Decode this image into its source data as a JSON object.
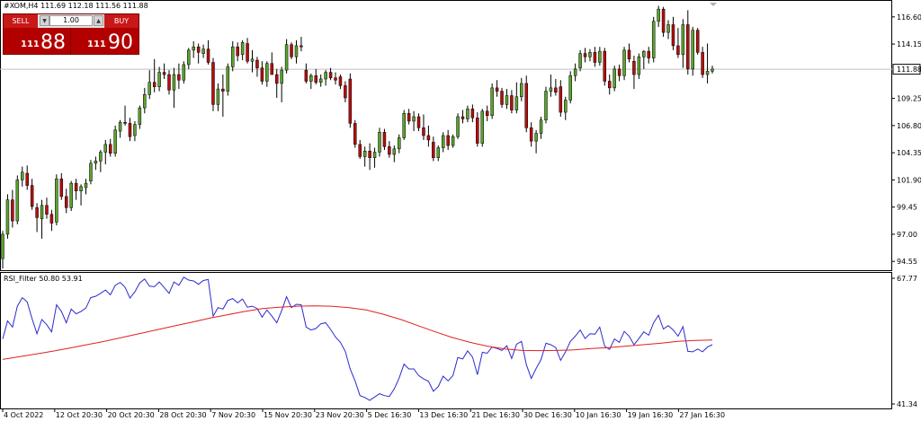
{
  "header": {
    "title": "#XOM,H4  111.69 112.18 111.56 111.88"
  },
  "trade_panel": {
    "sell_label": "SELL",
    "buy_label": "BUY",
    "lot": "1.00",
    "sell_price_small": "111",
    "sell_price_big": "88",
    "buy_price_small": "111",
    "buy_price_big": "90",
    "down_arrow": "▼",
    "up_arrow": "▲"
  },
  "colors": {
    "bull": "#5aa32d",
    "bear": "#b50e0e",
    "wick": "#000000",
    "price_line": "#c0c0c0",
    "price_label_bg": "#ffffff",
    "rsi_line": "#2b2bd0",
    "ma_line": "#e02020",
    "grid_border": "#000000"
  },
  "chart_data": [
    {
      "type": "candlestick",
      "title": "#XOM,H4  111.69 112.18 111.56 111.88",
      "y_ticks": [
        "116.60",
        "114.15",
        "111.88",
        "109.25",
        "106.80",
        "104.35",
        "101.90",
        "99.45",
        "97.00",
        "94.55"
      ],
      "current_price": "111.88",
      "ylim": [
        94.0,
        117.8
      ],
      "grid": false,
      "candles": [
        [
          94.8,
          97.3,
          93.9,
          97.0
        ],
        [
          97.0,
          100.6,
          96.6,
          100.1
        ],
        [
          100.1,
          101.0,
          97.6,
          98.2
        ],
        [
          98.2,
          102.3,
          97.9,
          101.9
        ],
        [
          101.9,
          103.1,
          101.3,
          102.6
        ],
        [
          102.5,
          103.2,
          101.0,
          101.4
        ],
        [
          101.4,
          102.0,
          99.2,
          99.5
        ],
        [
          99.4,
          99.8,
          97.2,
          98.5
        ],
        [
          98.4,
          100.1,
          96.6,
          99.6
        ],
        [
          99.6,
          100.3,
          98.4,
          98.8
        ],
        [
          98.8,
          99.2,
          97.3,
          98.0
        ],
        [
          98.1,
          102.4,
          97.8,
          102.0
        ],
        [
          102.0,
          102.5,
          100.1,
          100.4
        ],
        [
          100.4,
          101.1,
          98.9,
          99.4
        ],
        [
          99.4,
          101.8,
          99.1,
          101.6
        ],
        [
          101.6,
          102.0,
          100.1,
          100.9
        ],
        [
          100.9,
          101.5,
          99.6,
          101.3
        ],
        [
          101.2,
          102.0,
          100.6,
          101.6
        ],
        [
          101.8,
          103.7,
          101.5,
          103.4
        ],
        [
          103.4,
          104.0,
          102.8,
          103.6
        ],
        [
          103.6,
          104.6,
          102.6,
          104.4
        ],
        [
          104.4,
          105.5,
          103.3,
          105.1
        ],
        [
          105.1,
          105.6,
          104.0,
          104.3
        ],
        [
          104.3,
          106.8,
          104.0,
          106.4
        ],
        [
          106.3,
          107.3,
          105.7,
          107.1
        ],
        [
          107.1,
          108.6,
          106.8,
          107.0
        ],
        [
          107.0,
          107.5,
          105.4,
          105.8
        ],
        [
          105.9,
          107.2,
          105.4,
          106.9
        ],
        [
          106.9,
          108.6,
          106.5,
          108.4
        ],
        [
          108.4,
          110.2,
          107.9,
          109.6
        ],
        [
          109.6,
          111.8,
          109.2,
          110.7
        ],
        [
          110.7,
          112.8,
          109.8,
          110.3
        ],
        [
          110.3,
          112.1,
          109.9,
          111.6
        ],
        [
          111.6,
          112.4,
          111.0,
          111.4
        ],
        [
          111.4,
          111.8,
          109.6,
          110.0
        ],
        [
          110.0,
          112.0,
          108.4,
          111.4
        ],
        [
          111.4,
          112.4,
          110.1,
          110.9
        ],
        [
          110.9,
          112.6,
          110.6,
          112.3
        ],
        [
          112.3,
          113.8,
          111.9,
          113.6
        ],
        [
          113.6,
          114.4,
          112.9,
          113.9
        ],
        [
          113.9,
          114.2,
          112.4,
          113.4
        ],
        [
          113.3,
          114.1,
          112.9,
          113.7
        ],
        [
          113.7,
          114.5,
          112.3,
          112.5
        ],
        [
          112.5,
          112.9,
          108.1,
          108.7
        ],
        [
          108.7,
          110.6,
          108.1,
          110.1
        ],
        [
          110.1,
          111.4,
          107.6,
          109.9
        ],
        [
          109.9,
          112.4,
          109.5,
          112.1
        ],
        [
          112.1,
          114.4,
          111.7,
          113.9
        ],
        [
          113.9,
          114.3,
          112.6,
          113.1
        ],
        [
          113.2,
          114.5,
          112.7,
          114.3
        ],
        [
          114.2,
          114.7,
          112.4,
          112.6
        ],
        [
          112.6,
          113.6,
          111.6,
          112.8
        ],
        [
          112.7,
          113.0,
          111.2,
          112.0
        ],
        [
          112.0,
          112.6,
          110.5,
          110.8
        ],
        [
          110.8,
          112.6,
          110.3,
          112.4
        ],
        [
          112.4,
          113.4,
          111.6,
          111.4
        ],
        [
          111.4,
          111.9,
          109.3,
          110.6
        ],
        [
          110.6,
          112.1,
          108.9,
          111.8
        ],
        [
          111.8,
          114.6,
          111.5,
          114.1
        ],
        [
          114.1,
          114.3,
          112.8,
          113.0
        ],
        [
          113.0,
          114.5,
          112.4,
          114.0
        ],
        [
          114.0,
          114.8,
          113.5,
          113.9
        ],
        [
          111.8,
          112.4,
          110.6,
          110.8
        ],
        [
          110.8,
          111.5,
          110.1,
          111.3
        ],
        [
          111.3,
          111.9,
          110.5,
          110.7
        ],
        [
          110.7,
          111.4,
          110.3,
          111.0
        ],
        [
          111.0,
          111.8,
          110.4,
          111.6
        ],
        [
          111.6,
          112.0,
          110.9,
          111.1
        ],
        [
          111.1,
          111.6,
          110.5,
          110.9
        ],
        [
          111.2,
          111.4,
          110.1,
          110.4
        ],
        [
          110.4,
          110.8,
          108.9,
          109.3
        ],
        [
          111.0,
          111.5,
          106.6,
          107.0
        ],
        [
          107.0,
          107.3,
          104.8,
          105.1
        ],
        [
          105.1,
          105.5,
          103.8,
          104.0
        ],
        [
          104.0,
          104.9,
          103.1,
          104.5
        ],
        [
          104.5,
          105.2,
          102.8,
          103.9
        ],
        [
          103.9,
          104.8,
          103.0,
          104.4
        ],
        [
          104.4,
          106.6,
          104.0,
          106.2
        ],
        [
          106.2,
          106.5,
          104.6,
          104.9
        ],
        [
          104.9,
          105.4,
          103.9,
          104.2
        ],
        [
          104.2,
          105.0,
          103.5,
          104.7
        ],
        [
          104.7,
          106.0,
          104.3,
          105.7
        ],
        [
          105.7,
          108.2,
          105.5,
          107.9
        ],
        [
          107.9,
          108.3,
          106.9,
          107.2
        ],
        [
          107.2,
          108.1,
          106.3,
          107.6
        ],
        [
          107.6,
          107.9,
          106.3,
          106.6
        ],
        [
          106.6,
          107.8,
          105.5,
          105.9
        ],
        [
          105.9,
          106.8,
          104.9,
          105.5
        ],
        [
          105.3,
          105.8,
          103.6,
          103.9
        ],
        [
          103.9,
          105.0,
          103.6,
          104.8
        ],
        [
          104.8,
          106.2,
          104.4,
          105.9
        ],
        [
          105.9,
          106.4,
          104.6,
          105.0
        ],
        [
          105.0,
          106.0,
          104.8,
          105.8
        ],
        [
          105.8,
          107.9,
          105.6,
          107.6
        ],
        [
          107.6,
          108.2,
          107.0,
          107.4
        ],
        [
          107.4,
          108.6,
          107.1,
          108.3
        ],
        [
          108.3,
          108.7,
          107.1,
          107.5
        ],
        [
          107.5,
          108.0,
          104.9,
          105.2
        ],
        [
          105.2,
          108.3,
          104.9,
          108.1
        ],
        [
          108.1,
          108.6,
          107.2,
          107.7
        ],
        [
          107.7,
          110.6,
          107.4,
          110.2
        ],
        [
          110.2,
          110.9,
          109.4,
          109.9
        ],
        [
          109.9,
          110.2,
          108.4,
          108.7
        ],
        [
          108.7,
          110.1,
          108.3,
          109.5
        ],
        [
          109.5,
          110.0,
          107.9,
          108.2
        ],
        [
          108.2,
          110.7,
          107.9,
          109.4
        ],
        [
          109.4,
          111.1,
          109.0,
          110.6
        ],
        [
          110.6,
          111.3,
          106.2,
          106.6
        ],
        [
          106.6,
          107.1,
          104.9,
          105.4
        ],
        [
          105.4,
          106.4,
          104.3,
          106.1
        ],
        [
          106.1,
          107.6,
          105.6,
          107.3
        ],
        [
          107.3,
          110.3,
          107.0,
          109.9
        ],
        [
          109.9,
          111.4,
          109.4,
          110.2
        ],
        [
          110.2,
          111.0,
          109.5,
          109.8
        ],
        [
          110.3,
          110.9,
          107.6,
          108.0
        ],
        [
          108.0,
          109.4,
          107.3,
          109.1
        ],
        [
          109.1,
          111.7,
          108.8,
          111.3
        ],
        [
          111.3,
          112.4,
          110.8,
          111.9
        ],
        [
          112.0,
          113.6,
          111.7,
          113.3
        ],
        [
          113.3,
          113.8,
          112.5,
          113.0
        ],
        [
          113.0,
          113.7,
          112.6,
          113.4
        ],
        [
          113.4,
          113.9,
          112.1,
          112.5
        ],
        [
          112.5,
          113.9,
          112.2,
          113.5
        ],
        [
          113.5,
          113.8,
          110.4,
          110.8
        ],
        [
          110.8,
          111.4,
          109.6,
          110.2
        ],
        [
          110.2,
          112.2,
          109.9,
          111.9
        ],
        [
          111.9,
          112.3,
          110.8,
          111.3
        ],
        [
          111.3,
          113.9,
          110.9,
          113.6
        ],
        [
          113.6,
          114.2,
          112.5,
          112.8
        ],
        [
          112.6,
          113.1,
          110.1,
          111.4
        ],
        [
          111.4,
          113.3,
          111.0,
          113.0
        ],
        [
          113.0,
          113.6,
          111.9,
          113.5
        ],
        [
          113.5,
          113.9,
          112.4,
          112.9
        ],
        [
          112.9,
          116.6,
          112.5,
          116.2
        ],
        [
          116.2,
          117.6,
          115.7,
          117.3
        ],
        [
          117.3,
          117.5,
          114.8,
          115.2
        ],
        [
          115.2,
          116.3,
          114.6,
          115.9
        ],
        [
          115.9,
          116.6,
          113.6,
          114.0
        ],
        [
          114.0,
          115.6,
          112.9,
          113.2
        ],
        [
          113.2,
          116.4,
          112.0,
          115.9
        ],
        [
          115.9,
          117.2,
          111.4,
          111.9
        ],
        [
          111.9,
          115.7,
          111.3,
          115.4
        ],
        [
          115.4,
          115.6,
          113.2,
          113.4
        ],
        [
          113.4,
          113.9,
          111.1,
          111.4
        ],
        [
          111.4,
          114.2,
          110.6,
          111.7
        ],
        [
          111.7,
          112.2,
          111.5,
          111.9
        ]
      ],
      "indicator": {
        "title": "RSI_Filter 50.80 53.91",
        "y_ticks": [
          "67.77",
          "41.34"
        ],
        "ylim": [
          41.34,
          67.77
        ],
        "series": [
          {
            "name": "RSI",
            "values": [
              55.0,
              58.8,
              57.5,
              61.9,
              63.7,
              62.8,
              59.3,
              56.1,
              59.1,
              58.0,
              56.5,
              62.2,
              60.8,
              58.4,
              61.3,
              60.3,
              60.8,
              61.5,
              63.7,
              64.0,
              64.6,
              65.3,
              64.3,
              66.3,
              66.9,
              65.9,
              63.6,
              64.9,
              66.8,
              67.6,
              66.1,
              66.0,
              67.0,
              65.8,
              64.6,
              67.0,
              66.3,
              68.0,
              67.4,
              67.2,
              66.5,
              67.3,
              67.5,
              59.8,
              61.6,
              61.3,
              63.1,
              63.5,
              62.6,
              63.4,
              61.7,
              61.9,
              61.4,
              59.6,
              61.1,
              59.8,
              58.4,
              61.0,
              63.9,
              61.6,
              62.3,
              62.2,
              57.5,
              56.9,
              57.2,
              58.2,
              58.4,
              57.0,
              55.4,
              54.3,
              52.4,
              48.7,
              46.2,
              43.1,
              42.7,
              42.1,
              42.8,
              43.5,
              43.1,
              42.9,
              44.5,
              46.8,
              49.7,
              48.7,
              48.7,
              47.3,
              46.6,
              46.1,
              44.0,
              45.0,
              47.2,
              46.2,
              47.3,
              51.1,
              50.8,
              52.5,
              51.2,
              47.5,
              52.2,
              52.0,
              53.3,
              53.0,
              52.6,
              53.6,
              50.9,
              53.9,
              54.5,
              49.6,
              46.7,
              48.8,
              50.7,
              54.1,
              53.8,
              53.2,
              50.5,
              52.3,
              54.5,
              55.6,
              56.9,
              55.1,
              56.1,
              56.0,
              57.5,
              53.5,
              52.8,
              55.0,
              54.3,
              56.6,
              55.6,
              53.8,
              55.1,
              56.5,
              55.8,
              58.4,
              60.0,
              57.1,
              57.8,
              56.9,
              55.6,
              57.6,
              52.4,
              52.3,
              52.9,
              52.3,
              53.3,
              53.8
            ]
          },
          {
            "name": "Signal",
            "values": [
              50.7,
              51.3,
              51.9,
              52.5,
              53.2,
              53.9,
              54.6,
              55.4,
              56.2,
              57.0,
              57.8,
              58.6,
              59.4,
              60.1,
              60.8,
              61.4,
              61.7,
              61.9,
              61.95,
              61.9,
              61.6,
              61.1,
              60.2,
              59.1,
              57.8,
              56.5,
              55.3,
              54.3,
              53.5,
              52.9,
              52.6,
              52.55,
              52.6,
              52.7,
              53.0,
              53.2,
              53.5,
              53.8,
              54.1,
              54.5,
              54.7,
              54.8
            ]
          }
        ]
      },
      "x_tick_labels": [
        "4 Oct 2022",
        "12 Oct 20:30",
        "20 Oct 20:30",
        "28 Oct 20:30",
        "7 Nov 20:30",
        "15 Nov 20:30",
        "23 Nov 20:30",
        "5 Dec 16:30",
        "13 Dec 16:30",
        "21 Dec 16:30",
        "30 Dec 16:30",
        "10 Jan 16:30",
        "19 Jan 16:30",
        "27 Jan 16:30"
      ]
    }
  ]
}
